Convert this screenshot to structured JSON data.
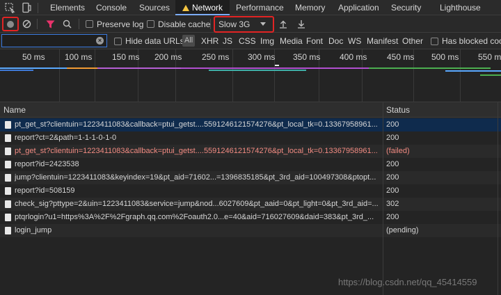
{
  "tabs": [
    {
      "label": "Elements"
    },
    {
      "label": "Console"
    },
    {
      "label": "Sources"
    },
    {
      "label": "Network"
    },
    {
      "label": "Performance"
    },
    {
      "label": "Memory"
    },
    {
      "label": "Application"
    },
    {
      "label": "Security"
    },
    {
      "label": "Lighthouse"
    }
  ],
  "toolbar": {
    "preserve_log": "Preserve log",
    "disable_cache": "Disable cache",
    "throttling": "Slow 3G"
  },
  "filter": {
    "hide_data_urls": "Hide data URLs",
    "all": "All",
    "types": [
      "XHR",
      "JS",
      "CSS",
      "Img",
      "Media",
      "Font",
      "Doc",
      "WS",
      "Manifest",
      "Other"
    ],
    "has_blocked": "Has blocked cookies"
  },
  "overview": {
    "ticks": [
      "50 ms",
      "100 ms",
      "150 ms",
      "200 ms",
      "250 ms",
      "300 ms",
      "350 ms",
      "400 ms",
      "450 ms",
      "500 ms",
      "550 m"
    ]
  },
  "table": {
    "columns": [
      "Name",
      "Status"
    ],
    "rows": [
      {
        "name": "pt_get_st?clientuin=1223411083&callback=ptui_getst....5591246121574276&pt_local_tk=0.13367958961...",
        "status": "200"
      },
      {
        "name": "report?ct=2&path=1-1-1-0-1-0",
        "status": "200"
      },
      {
        "name": "pt_get_st?clientuin=1223411083&callback=ptui_getst....5591246121574276&pt_local_tk=0.13367958961...",
        "status": "(failed)"
      },
      {
        "name": "report?id=2423538",
        "status": "200"
      },
      {
        "name": "jump?clientuin=1223411083&keyindex=19&pt_aid=71602...=1396835185&pt_3rd_aid=100497308&ptopt...",
        "status": "200"
      },
      {
        "name": "report?id=508159",
        "status": "200"
      },
      {
        "name": "check_sig?pttype=2&uin=1223411083&service=jump&nod...6027609&pt_aaid=0&pt_light=0&pt_3rd_aid=...",
        "status": "302"
      },
      {
        "name": "ptqrlogin?u1=https%3A%2F%2Fgraph.qq.com%2Foauth2.0...e=40&aid=716027609&daid=383&pt_3rd_...",
        "status": "200"
      },
      {
        "name": "login_jump",
        "status": "(pending)"
      }
    ]
  },
  "watermark": "https://blog.csdn.net/qq_45414559"
}
